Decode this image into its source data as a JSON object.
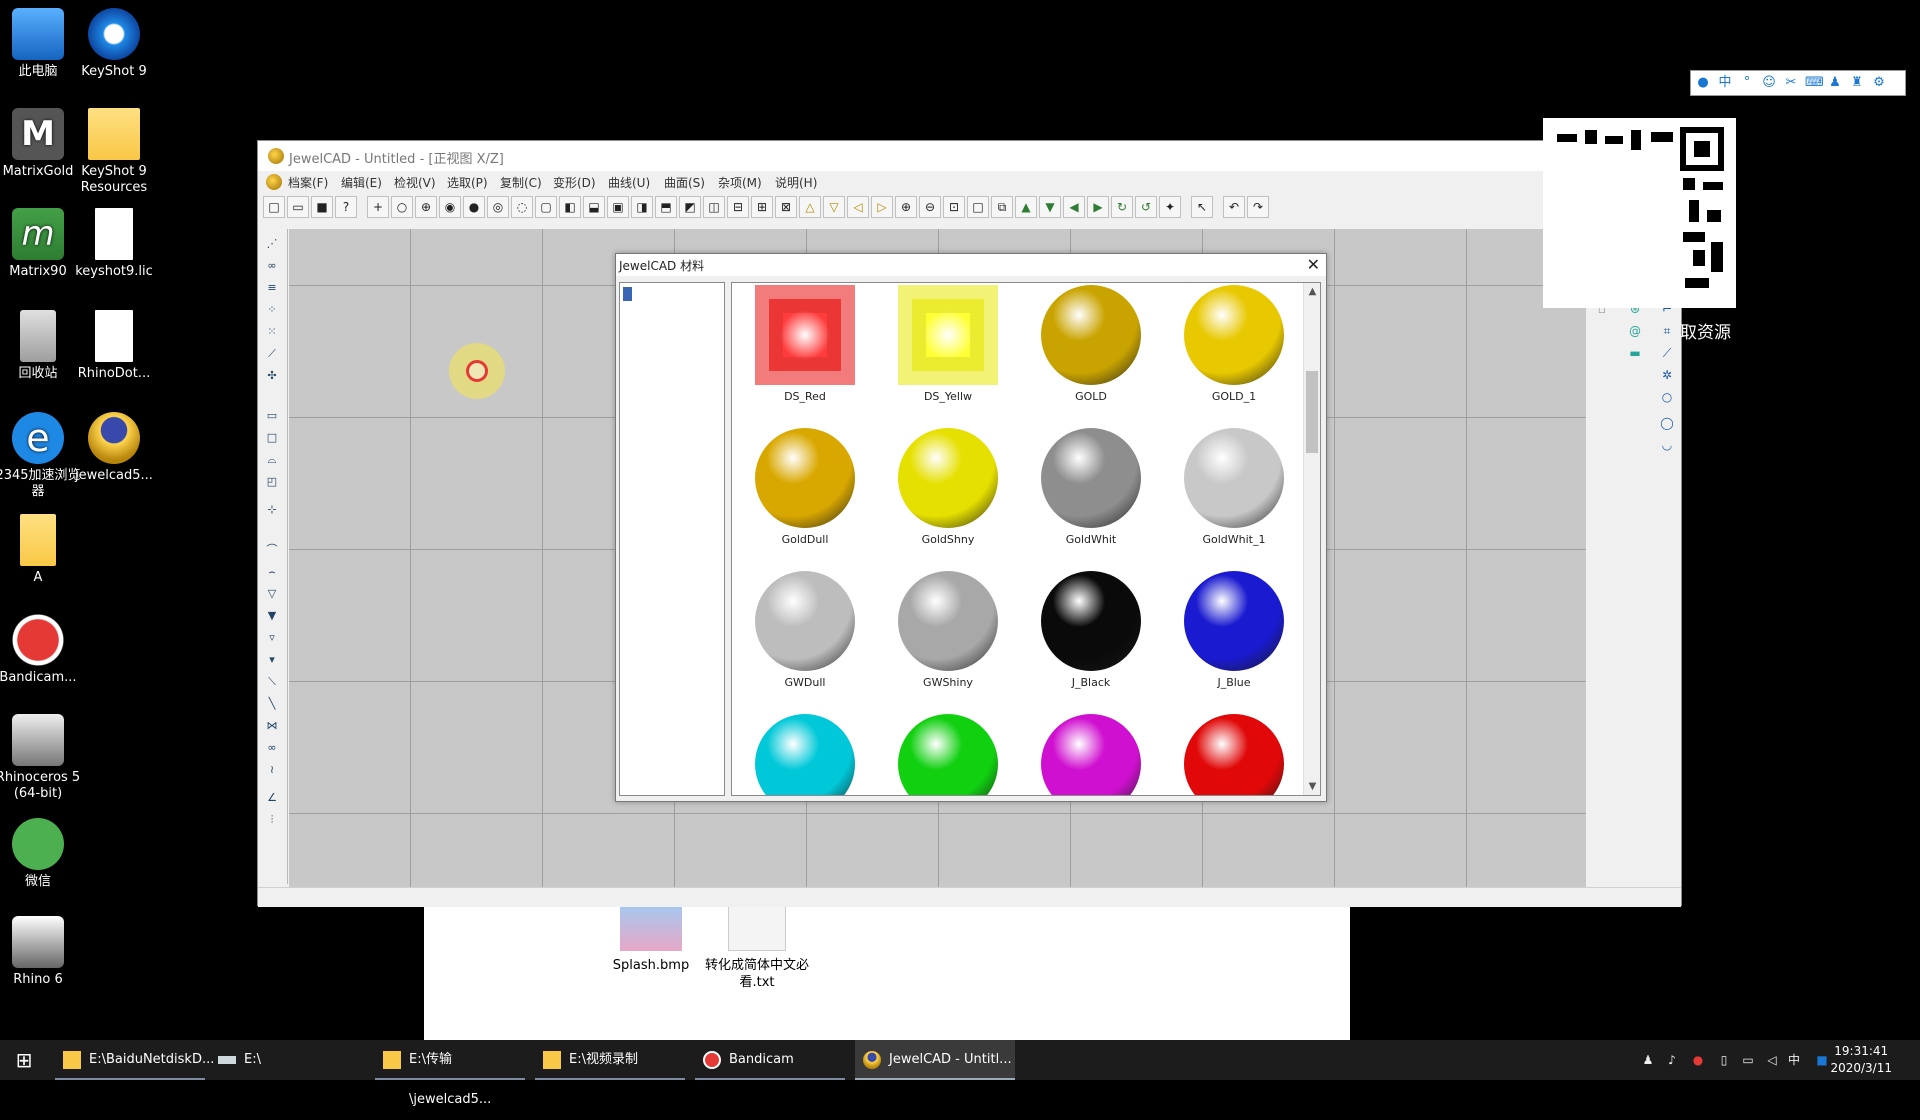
{
  "desktop": {
    "icons": [
      {
        "label": "此电脑"
      },
      {
        "label": "KeyShot 9"
      },
      {
        "label": "MatrixGold"
      },
      {
        "label": "KeyShot 9 Resources"
      },
      {
        "label": "Matrix90"
      },
      {
        "label": "keyshot9.lic"
      },
      {
        "label": "回收站"
      },
      {
        "label": "RhinoDot..."
      },
      {
        "label": "2345加速浏览器"
      },
      {
        "label": "jewelcad5..."
      },
      {
        "label": "A"
      },
      {
        "label": "Bandicam..."
      },
      {
        "label": "Rhinoceros 5 (64-bit)"
      },
      {
        "label": "微信"
      },
      {
        "label": "Rhino 6"
      }
    ]
  },
  "explorer": {
    "files": [
      {
        "label": "Splash.bmp"
      },
      {
        "label": "转化成简体中文必看.txt"
      }
    ]
  },
  "jewelcad": {
    "title": "JewelCAD - Untitled - [正视图 X/Z]",
    "menu": [
      "档案(F)",
      "编辑(E)",
      "检视(V)",
      "选取(P)",
      "复制(C)",
      "变形(D)",
      "曲线(U)",
      "曲面(S)",
      "杂项(M)",
      "说明(H)"
    ],
    "window_buttons": {
      "minimize": "—",
      "maximize": "☐",
      "close": "✕"
    },
    "mdi_buttons": {
      "minimize": "_",
      "restore": "❐",
      "close": "✕"
    }
  },
  "material_dialog": {
    "title": "JewelCAD 材料",
    "close": "✕",
    "scroll_up": "▲",
    "scroll_down": "▼",
    "materials": [
      {
        "name": "DS_Red",
        "kind": "gem",
        "color": "#ff3b3b"
      },
      {
        "name": "DS_Yellw",
        "kind": "gem",
        "color": "#ffff33"
      },
      {
        "name": "GOLD",
        "kind": "sphere",
        "color": "#c9a400"
      },
      {
        "name": "GOLD_1",
        "kind": "sphere",
        "color": "#e8c800"
      },
      {
        "name": "GoldDull",
        "kind": "sphere",
        "color": "#d9a800"
      },
      {
        "name": "GoldShny",
        "kind": "sphere",
        "color": "#e6e000"
      },
      {
        "name": "GoldWhit",
        "kind": "sphere",
        "color": "#8e8e8e"
      },
      {
        "name": "GoldWhit_1",
        "kind": "sphere",
        "color": "#c8c8c8"
      },
      {
        "name": "GWDull",
        "kind": "sphere",
        "color": "#bdbdbd"
      },
      {
        "name": "GWShiny",
        "kind": "sphere",
        "color": "#a8a8a8"
      },
      {
        "name": "J_Black",
        "kind": "sphere",
        "color": "#0a0a0a"
      },
      {
        "name": "J_Blue",
        "kind": "sphere",
        "color": "#1a1ad0"
      },
      {
        "name": "",
        "kind": "sphere",
        "color": "#00c8d8"
      },
      {
        "name": "",
        "kind": "sphere",
        "color": "#10d010"
      },
      {
        "name": "",
        "kind": "sphere",
        "color": "#d010d0"
      },
      {
        "name": "",
        "kind": "sphere",
        "color": "#e00808"
      }
    ]
  },
  "side_panel": {
    "text": "取资源"
  },
  "taskbar": {
    "start": "⊞",
    "items": [
      {
        "label": "E:\\BaiduNetdiskD..."
      },
      {
        "label": "E:\\"
      },
      {
        "label": "E:\\传输\\jewelcad5..."
      },
      {
        "label": "E:\\视频录制"
      },
      {
        "label": "Bandicam"
      },
      {
        "label": "JewelCAD - Untitl..."
      }
    ],
    "ime_lang": "中",
    "time": "19:31:41",
    "date": "2020/3/11"
  }
}
